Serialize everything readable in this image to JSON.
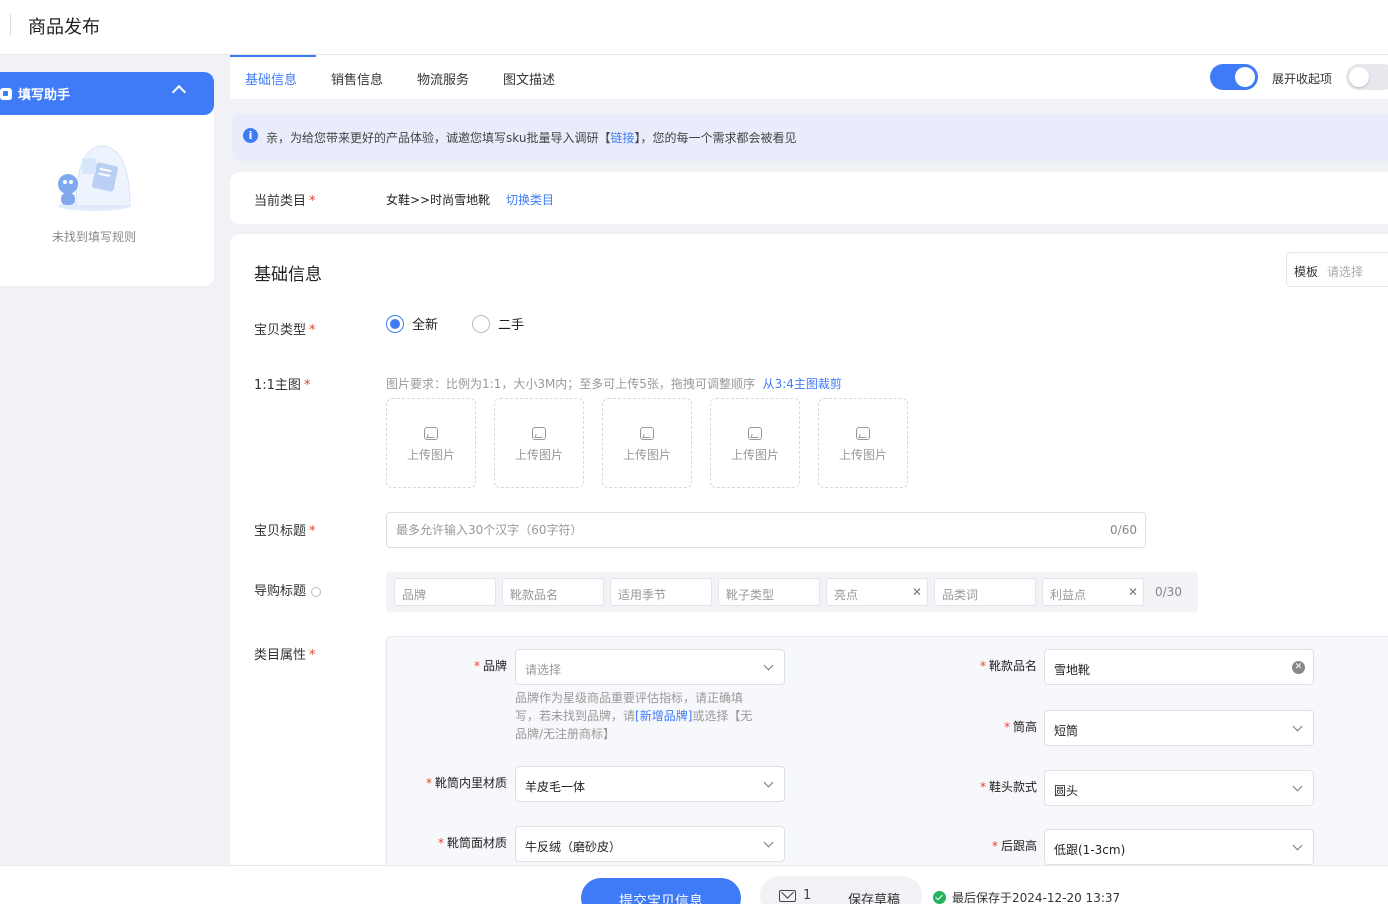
{
  "header": {
    "title": "商品发布"
  },
  "sidebar": {
    "helper_title": "填写助手",
    "empty_text": "未找到填写规则"
  },
  "tabs": [
    {
      "label": "基础信息",
      "active": true
    },
    {
      "label": "销售信息",
      "active": false
    },
    {
      "label": "物流服务",
      "active": false
    },
    {
      "label": "图文描述",
      "active": false
    }
  ],
  "toolbar": {
    "expand_label": "展开收起项",
    "expand_on": true,
    "second_toggle_on": false
  },
  "notice": {
    "text_before": "亲，为给您带来更好的产品体验，诚邀您填写sku批量导入调研【",
    "link": "链接",
    "text_after": "】，您的每一个需求都会被看见"
  },
  "category": {
    "label": "当前类目",
    "value": "女鞋>>时尚雪地靴",
    "switch_label": "切换类目"
  },
  "basic": {
    "section_title": "基础信息",
    "template_label": "模板",
    "template_placeholder": "请选择",
    "item_type_label": "宝贝类型",
    "item_type_options": [
      "全新",
      "二手"
    ],
    "item_type_selected": "全新",
    "main_image_label": "1:1主图",
    "image_hint": "图片要求：比例为1:1，大小3M内；至多可上传5张，拖拽可调整顺序",
    "image_hint_link": "从3:4主图裁剪",
    "upload_label": "上传图片",
    "title_label": "宝贝标题",
    "title_placeholder": "最多允许输入30个汉字（60字符）",
    "title_count": "0/60",
    "guide_label": "导购标题",
    "guide_chips": [
      "品牌",
      "靴款品名",
      "适用季节",
      "靴子类型",
      "亮点",
      "品类词",
      "利益点"
    ],
    "guide_count": "0/30",
    "attr_label": "类目属性"
  },
  "attributes": {
    "brand": {
      "label": "品牌",
      "placeholder": "请选择",
      "value": ""
    },
    "brand_tip_before": "品牌作为星级商品重要评估指标，请正确填写，若未找到品牌，请",
    "brand_tip_link": "[新增品牌]",
    "brand_tip_after": "或选择【无品牌/无注册商标】",
    "style_name": {
      "label": "靴款品名",
      "value": "雪地靴"
    },
    "shaft_height": {
      "label": "筒高",
      "value": "短筒"
    },
    "lining": {
      "label": "靴筒内里材质",
      "value": "羊皮毛一体"
    },
    "toe": {
      "label": "鞋头款式",
      "value": "圆头"
    },
    "upper": {
      "label": "靴筒面材质",
      "value": "牛反绒（磨砂皮）"
    },
    "heel": {
      "label": "后跟高",
      "value": "低跟(1-3cm)"
    }
  },
  "footer": {
    "submit_label": "提交宝贝信息",
    "draft_count": "1",
    "draft_label": "保存草稿",
    "saved_text": "最后保存于2024-12-20 13:37"
  },
  "colors": {
    "primary": "#3f7bf6",
    "required": "#e5432d",
    "success": "#22b35e"
  }
}
